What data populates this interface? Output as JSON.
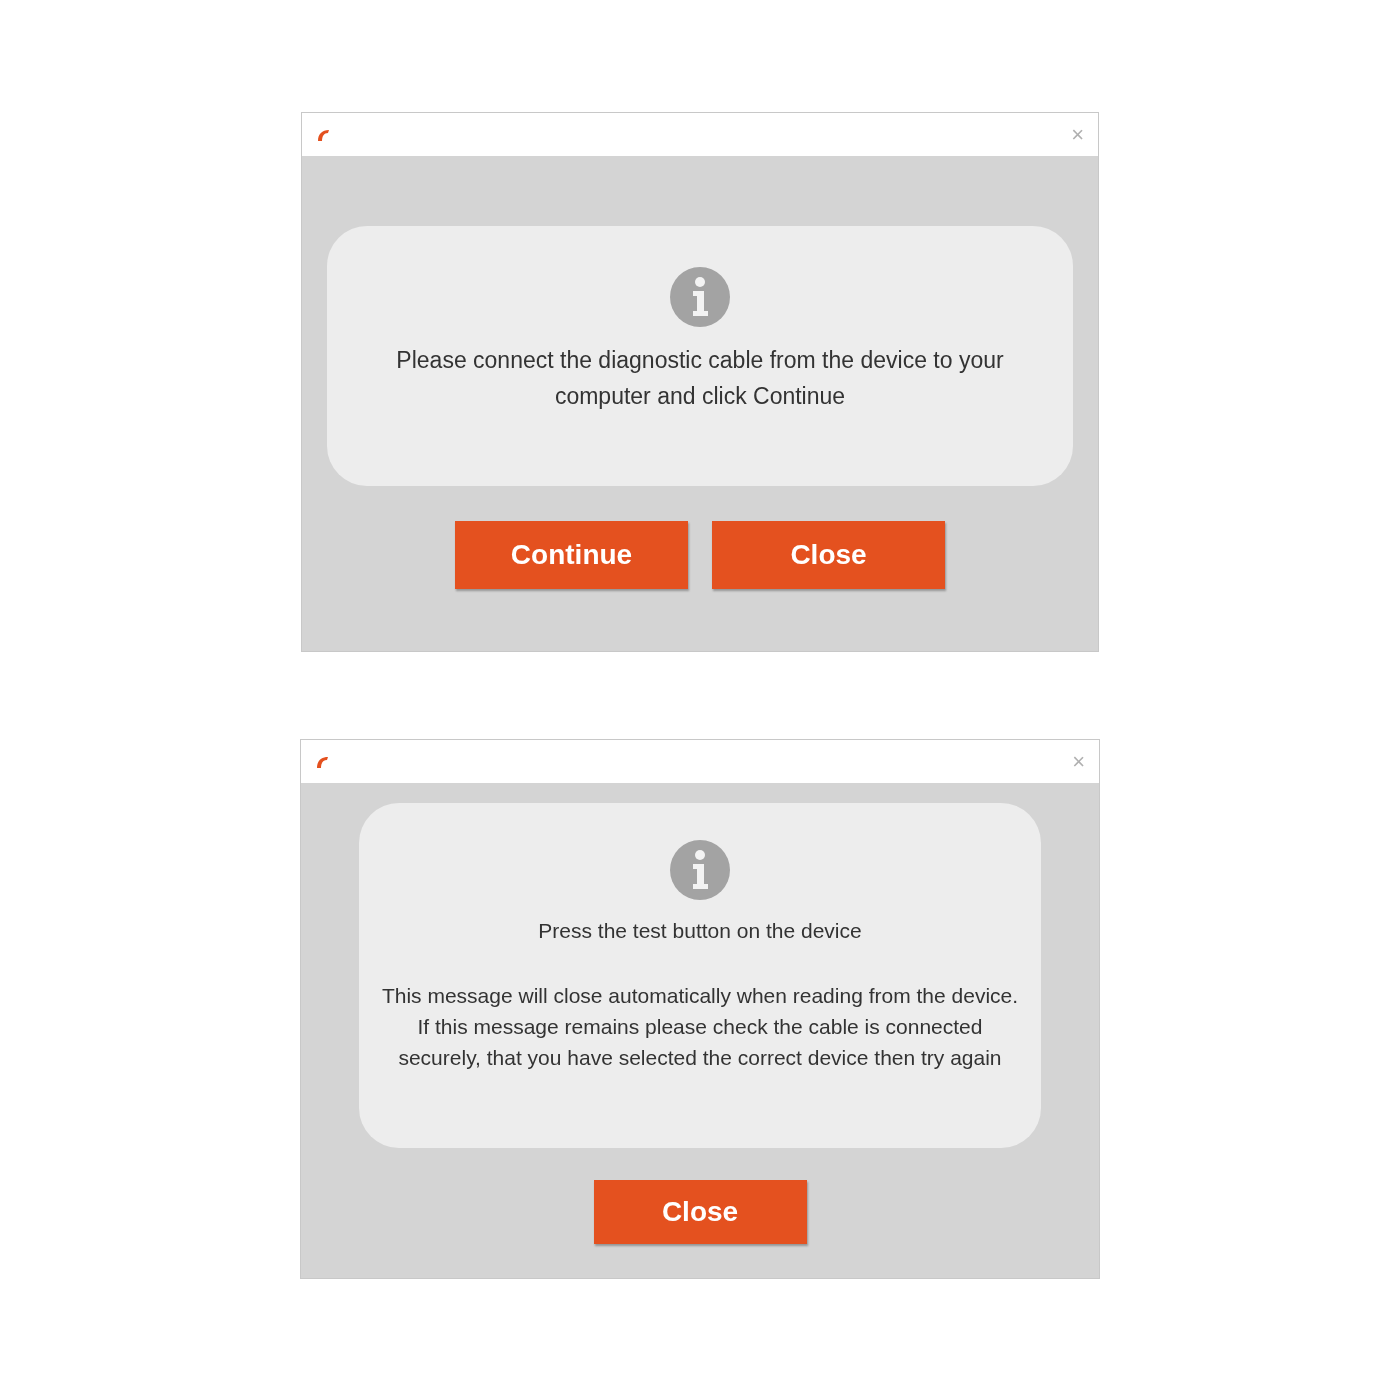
{
  "dialogs": [
    {
      "close_glyph": "×",
      "messages": [
        "Please connect the diagnostic cable from the device to your computer and click Continue"
      ],
      "buttons": [
        "Continue",
        "Close"
      ]
    },
    {
      "close_glyph": "×",
      "messages": [
        "Press the test button on the device",
        "This message will close automatically when reading from the device. If this message remains please check the cable is connected securely, that you have selected the correct device then try again"
      ],
      "buttons": [
        "Close"
      ]
    }
  ]
}
